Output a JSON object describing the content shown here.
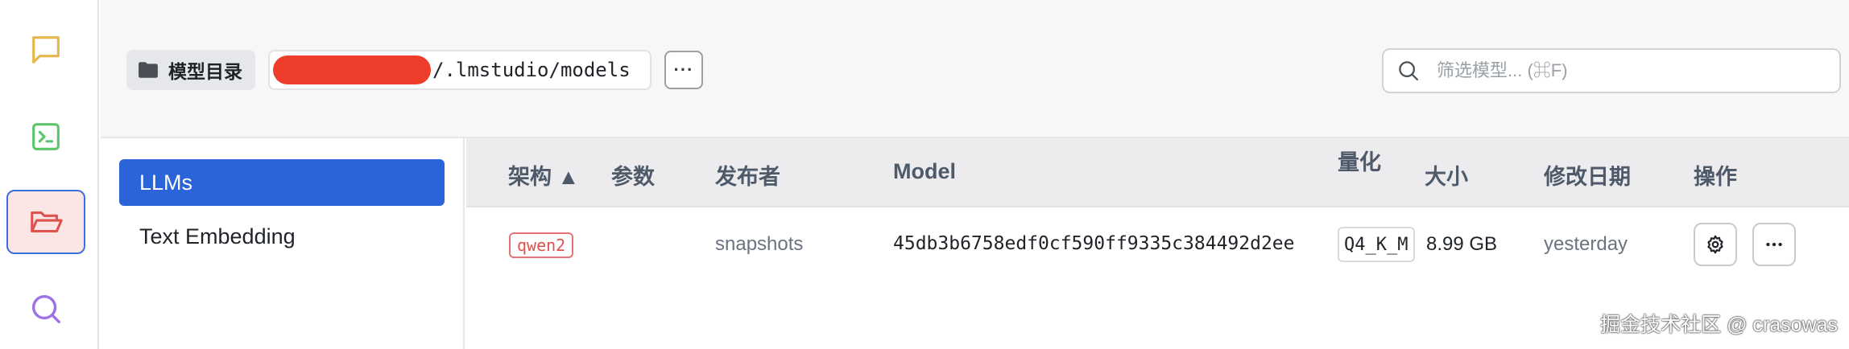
{
  "rail": {
    "items": [
      {
        "name": "chat",
        "icon": "chat-bubble-icon",
        "color": "#e6b64a"
      },
      {
        "name": "terminal",
        "icon": "terminal-icon",
        "color": "#5cc46b"
      },
      {
        "name": "folder",
        "icon": "folder-open-icon",
        "color": "#e0524d",
        "active": true
      },
      {
        "name": "search",
        "icon": "search-icon",
        "color": "#a072e8"
      }
    ]
  },
  "header": {
    "dir_label": "模型目录",
    "path_suffix": "/.lmstudio/models",
    "more_label": "···",
    "search_placeholder": "筛选模型... (⌘F)"
  },
  "categories": {
    "items": [
      {
        "label": "LLMs",
        "active": true
      },
      {
        "label": "Text Embedding",
        "active": false
      }
    ]
  },
  "table": {
    "headers": {
      "arch": "架构 ▲",
      "params": "参数",
      "publisher": "发布者",
      "model": "Model",
      "quant": "量化",
      "size": "大小",
      "modified": "修改日期",
      "actions": "操作"
    },
    "rows": [
      {
        "arch": "qwen2",
        "params": "",
        "publisher": "snapshots",
        "model": "45db3b6758edf0cf590ff9335c384492d2ee",
        "quant": "Q4_K_M",
        "size": "8.99 GB",
        "modified": "yesterday"
      }
    ]
  },
  "watermark": "掘金技术社区 @ crasowas",
  "colors": {
    "accent": "#2b64d8",
    "redaction": "#ee3d2b",
    "tag": "#e0524d"
  }
}
